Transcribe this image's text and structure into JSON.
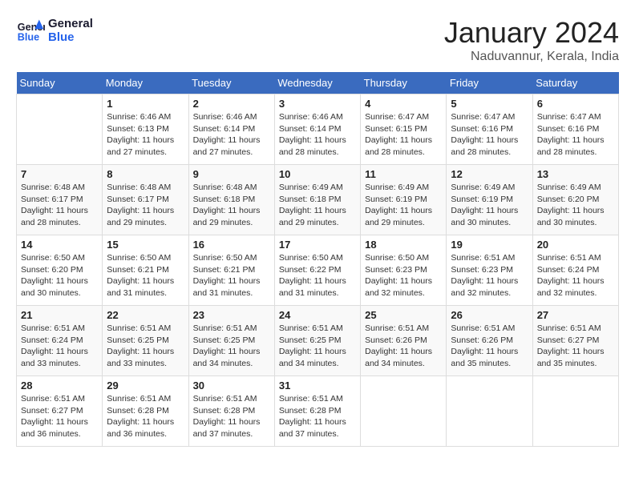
{
  "header": {
    "logo_general": "General",
    "logo_blue": "Blue",
    "month_title": "January 2024",
    "location": "Naduvannur, Kerala, India"
  },
  "weekdays": [
    "Sunday",
    "Monday",
    "Tuesday",
    "Wednesday",
    "Thursday",
    "Friday",
    "Saturday"
  ],
  "weeks": [
    [
      {
        "day": "",
        "info": ""
      },
      {
        "day": "1",
        "info": "Sunrise: 6:46 AM\nSunset: 6:13 PM\nDaylight: 11 hours\nand 27 minutes."
      },
      {
        "day": "2",
        "info": "Sunrise: 6:46 AM\nSunset: 6:14 PM\nDaylight: 11 hours\nand 27 minutes."
      },
      {
        "day": "3",
        "info": "Sunrise: 6:46 AM\nSunset: 6:14 PM\nDaylight: 11 hours\nand 28 minutes."
      },
      {
        "day": "4",
        "info": "Sunrise: 6:47 AM\nSunset: 6:15 PM\nDaylight: 11 hours\nand 28 minutes."
      },
      {
        "day": "5",
        "info": "Sunrise: 6:47 AM\nSunset: 6:16 PM\nDaylight: 11 hours\nand 28 minutes."
      },
      {
        "day": "6",
        "info": "Sunrise: 6:47 AM\nSunset: 6:16 PM\nDaylight: 11 hours\nand 28 minutes."
      }
    ],
    [
      {
        "day": "7",
        "info": "Sunrise: 6:48 AM\nSunset: 6:17 PM\nDaylight: 11 hours\nand 28 minutes."
      },
      {
        "day": "8",
        "info": "Sunrise: 6:48 AM\nSunset: 6:17 PM\nDaylight: 11 hours\nand 29 minutes."
      },
      {
        "day": "9",
        "info": "Sunrise: 6:48 AM\nSunset: 6:18 PM\nDaylight: 11 hours\nand 29 minutes."
      },
      {
        "day": "10",
        "info": "Sunrise: 6:49 AM\nSunset: 6:18 PM\nDaylight: 11 hours\nand 29 minutes."
      },
      {
        "day": "11",
        "info": "Sunrise: 6:49 AM\nSunset: 6:19 PM\nDaylight: 11 hours\nand 29 minutes."
      },
      {
        "day": "12",
        "info": "Sunrise: 6:49 AM\nSunset: 6:19 PM\nDaylight: 11 hours\nand 30 minutes."
      },
      {
        "day": "13",
        "info": "Sunrise: 6:49 AM\nSunset: 6:20 PM\nDaylight: 11 hours\nand 30 minutes."
      }
    ],
    [
      {
        "day": "14",
        "info": "Sunrise: 6:50 AM\nSunset: 6:20 PM\nDaylight: 11 hours\nand 30 minutes."
      },
      {
        "day": "15",
        "info": "Sunrise: 6:50 AM\nSunset: 6:21 PM\nDaylight: 11 hours\nand 31 minutes."
      },
      {
        "day": "16",
        "info": "Sunrise: 6:50 AM\nSunset: 6:21 PM\nDaylight: 11 hours\nand 31 minutes."
      },
      {
        "day": "17",
        "info": "Sunrise: 6:50 AM\nSunset: 6:22 PM\nDaylight: 11 hours\nand 31 minutes."
      },
      {
        "day": "18",
        "info": "Sunrise: 6:50 AM\nSunset: 6:23 PM\nDaylight: 11 hours\nand 32 minutes."
      },
      {
        "day": "19",
        "info": "Sunrise: 6:51 AM\nSunset: 6:23 PM\nDaylight: 11 hours\nand 32 minutes."
      },
      {
        "day": "20",
        "info": "Sunrise: 6:51 AM\nSunset: 6:24 PM\nDaylight: 11 hours\nand 32 minutes."
      }
    ],
    [
      {
        "day": "21",
        "info": "Sunrise: 6:51 AM\nSunset: 6:24 PM\nDaylight: 11 hours\nand 33 minutes."
      },
      {
        "day": "22",
        "info": "Sunrise: 6:51 AM\nSunset: 6:25 PM\nDaylight: 11 hours\nand 33 minutes."
      },
      {
        "day": "23",
        "info": "Sunrise: 6:51 AM\nSunset: 6:25 PM\nDaylight: 11 hours\nand 34 minutes."
      },
      {
        "day": "24",
        "info": "Sunrise: 6:51 AM\nSunset: 6:25 PM\nDaylight: 11 hours\nand 34 minutes."
      },
      {
        "day": "25",
        "info": "Sunrise: 6:51 AM\nSunset: 6:26 PM\nDaylight: 11 hours\nand 34 minutes."
      },
      {
        "day": "26",
        "info": "Sunrise: 6:51 AM\nSunset: 6:26 PM\nDaylight: 11 hours\nand 35 minutes."
      },
      {
        "day": "27",
        "info": "Sunrise: 6:51 AM\nSunset: 6:27 PM\nDaylight: 11 hours\nand 35 minutes."
      }
    ],
    [
      {
        "day": "28",
        "info": "Sunrise: 6:51 AM\nSunset: 6:27 PM\nDaylight: 11 hours\nand 36 minutes."
      },
      {
        "day": "29",
        "info": "Sunrise: 6:51 AM\nSunset: 6:28 PM\nDaylight: 11 hours\nand 36 minutes."
      },
      {
        "day": "30",
        "info": "Sunrise: 6:51 AM\nSunset: 6:28 PM\nDaylight: 11 hours\nand 37 minutes."
      },
      {
        "day": "31",
        "info": "Sunrise: 6:51 AM\nSunset: 6:28 PM\nDaylight: 11 hours\nand 37 minutes."
      },
      {
        "day": "",
        "info": ""
      },
      {
        "day": "",
        "info": ""
      },
      {
        "day": "",
        "info": ""
      }
    ]
  ]
}
